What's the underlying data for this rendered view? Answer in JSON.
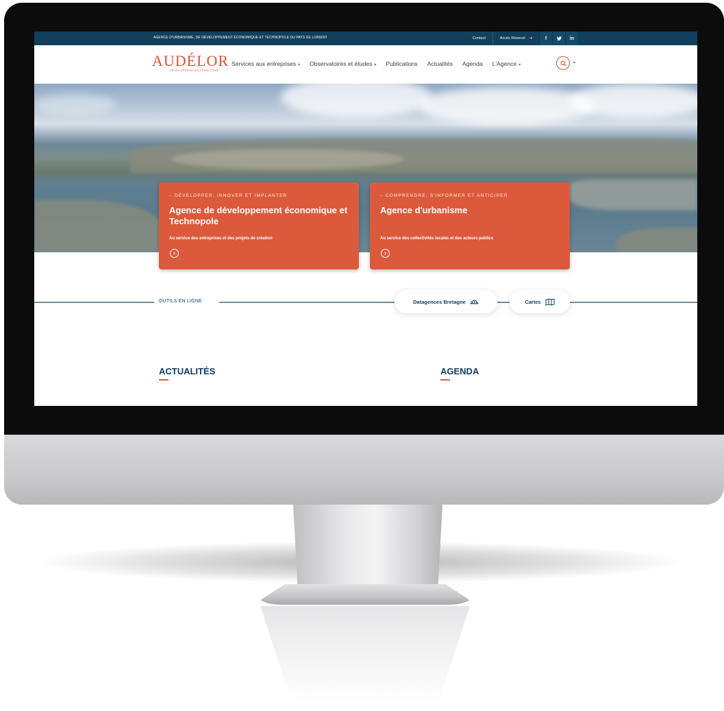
{
  "topbar": {
    "tagline": "AGENCE D'URBANISME, DE DÉVELOPPEMENT ÉCONOMIQUE ET TECHNOPOLE DU PAYS DE LORIENT",
    "contact": "Contact",
    "reserved": "Accès Réservé",
    "reserved_icon": "login-icon",
    "social": [
      "f",
      "t",
      "in"
    ]
  },
  "logo": {
    "main": "AUDÉLOR",
    "sub": "DÉVELOPPEUR DE TERRITOIRE"
  },
  "nav": {
    "items": [
      "Services aux entreprises",
      "Observatoires et études",
      "Publications",
      "Actualités",
      "Agenda",
      "L'Agence"
    ],
    "search_icon": "search-icon"
  },
  "cards": [
    {
      "eyebrow": "– DÉVELOPPER, INNOVER ET IMPLANTER",
      "title": "Agence de développement économique et Technopole",
      "desc": "Au service des entreprises et des projets de création"
    },
    {
      "eyebrow": "– COMPRENDRE, S'INFORMER ET ANTICIPER",
      "title": "Agence d'urbanisme",
      "desc": "Au service des collectivités locales et des acteurs publics"
    }
  ],
  "tools": {
    "label": "OUTILS EN LIGNE",
    "buttons": [
      "Datagences Bretagne",
      "Cartes"
    ]
  },
  "sections": {
    "news": "ACTUALITÉS",
    "agenda": "AGENDA"
  },
  "colors": {
    "primary_blue": "#11405c",
    "accent_orange": "#dc5a3c"
  }
}
